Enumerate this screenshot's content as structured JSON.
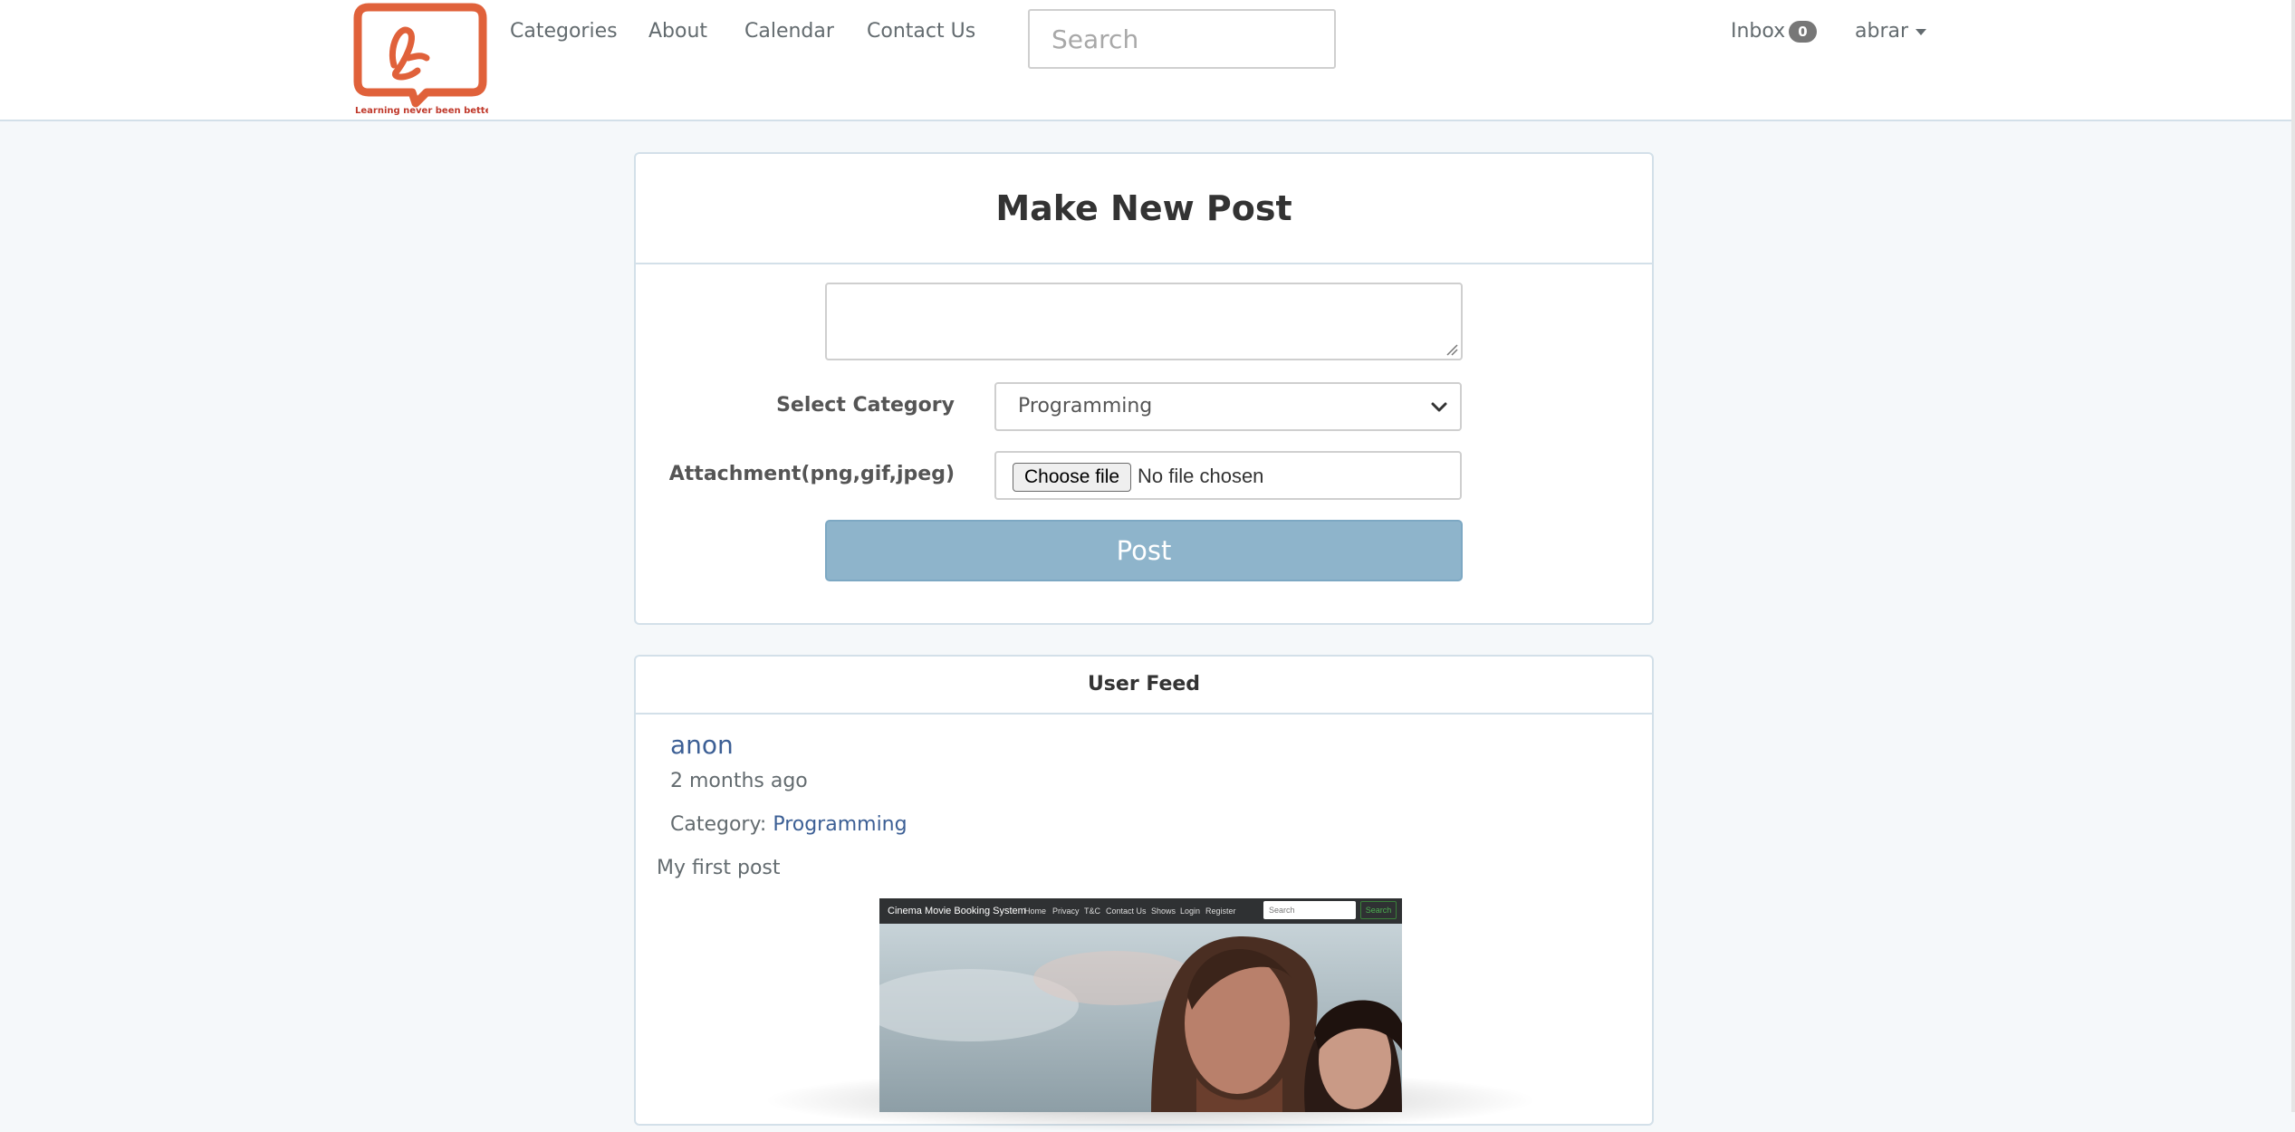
{
  "nav": {
    "logo_tagline": "Learning never been better!",
    "links": [
      "Categories",
      "About",
      "Calendar",
      "Contact Us"
    ],
    "search_placeholder": "Search",
    "inbox_label": "Inbox",
    "inbox_count": "0",
    "username": "abrar"
  },
  "post_form": {
    "title": "Make New Post",
    "category_label": "Select Category",
    "category_selected": "Programming",
    "attachment_label": "Attachment(png,gif,jpeg)",
    "file_button": "Choose file",
    "file_status": "No file chosen",
    "submit_label": "Post"
  },
  "feed": {
    "title": "User Feed",
    "post": {
      "author": "anon",
      "time": "2 months ago",
      "category_prefix": "Category:",
      "category": "Programming",
      "content": "My first post",
      "image": {
        "brand": "Cinema Movie Booking System",
        "links": [
          "Home",
          "Privacy",
          "T&C",
          "Contact Us",
          "Shows",
          "Login",
          "Register"
        ],
        "search_placeholder": "Search",
        "search_button": "Search"
      }
    }
  },
  "colors": {
    "link": "#3c5f95",
    "button": "#8eb4cb",
    "logo": "#e0613a",
    "border": "#d3e0e9"
  }
}
